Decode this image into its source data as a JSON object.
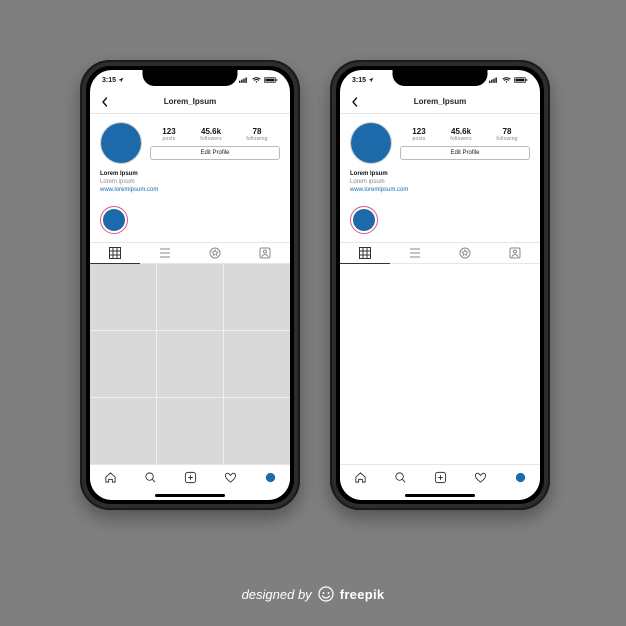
{
  "statusbar": {
    "time": "3:15",
    "carrier_dots": "..."
  },
  "header": {
    "username": "Lorem_Ipsum"
  },
  "profile": {
    "stats": {
      "posts": {
        "value": "123",
        "label": "posts"
      },
      "followers": {
        "value": "45.6k",
        "label": "followers"
      },
      "following": {
        "value": "78",
        "label": "following"
      }
    },
    "edit_label": "Edit Profile",
    "bio": {
      "name": "Lorem Ipsum",
      "line": "Lorem ipsum",
      "link": "www.loremipsum.com"
    }
  },
  "colors": {
    "accent": "#1d6aab"
  },
  "credit": {
    "by": "designed by",
    "brand": "freepik"
  }
}
